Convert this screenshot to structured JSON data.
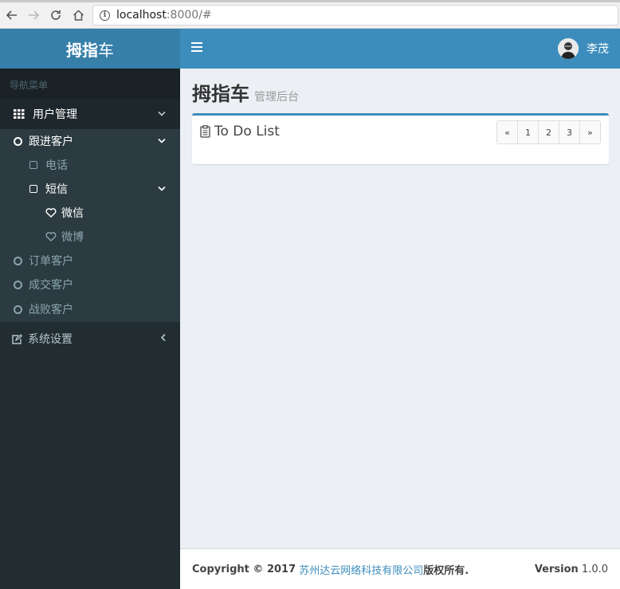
{
  "browser": {
    "url_host": "localhost",
    "url_rest": ":8000/#",
    "back_icon": "arrow-left-icon",
    "forward_icon": "arrow-right-icon",
    "reload_icon": "reload-icon",
    "home_icon": "home-icon"
  },
  "logo": {
    "bold": "拇指",
    "light": "车"
  },
  "sidebar": {
    "header": "导航菜单",
    "user_mgmt": {
      "label": "用户管理",
      "icon": "grid-icon"
    },
    "follow": {
      "label": "跟进客户"
    },
    "phone": {
      "label": "电话"
    },
    "sms": {
      "label": "短信"
    },
    "wechat": {
      "label": "微信"
    },
    "weibo": {
      "label": "微博"
    },
    "order": {
      "label": "订单客户"
    },
    "deal": {
      "label": "成交客户"
    },
    "lost": {
      "label": "战败客户"
    },
    "settings": {
      "label": "系统设置",
      "icon": "edit-icon"
    }
  },
  "header": {
    "user_name": "李茂"
  },
  "content": {
    "title": "拇指车",
    "subtitle": "管理后台",
    "box_title": "To Do List",
    "pager": [
      "«",
      "1",
      "2",
      "3",
      "»"
    ]
  },
  "footer": {
    "copyright": "Copyright © 2017",
    "company": "苏州达云网络科技有限公司",
    "rights": "版权所有.",
    "version_label": "Version",
    "version_value": "1.0.0"
  },
  "colors": {
    "header_blue": "#3c8dbc",
    "logo_blue": "#367fa9",
    "sidebar_dark": "#222d32"
  }
}
